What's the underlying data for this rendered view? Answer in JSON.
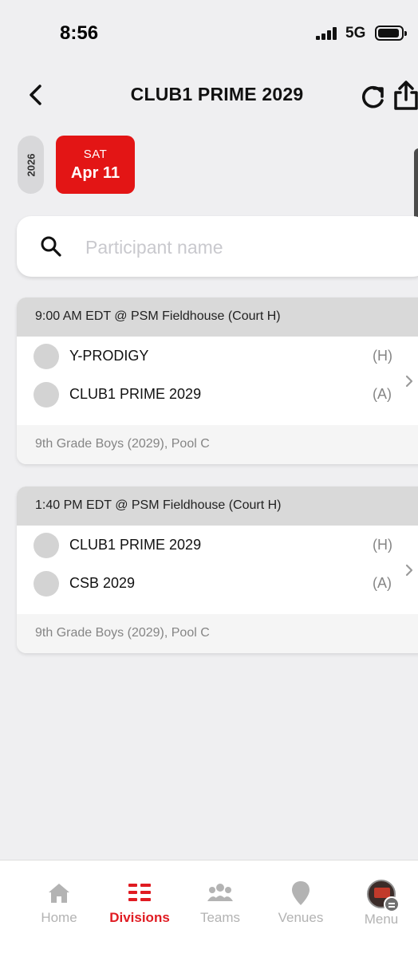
{
  "status": {
    "time": "8:56",
    "network": "5G"
  },
  "header": {
    "title": "CLUB1 PRIME 2029",
    "icons": {
      "back": "chevron-left-icon",
      "refresh": "refresh-icon",
      "share": "share-icon"
    }
  },
  "date_selector": {
    "year": "2026",
    "selected_day": "SAT",
    "selected_date": "Apr 11"
  },
  "search": {
    "placeholder": "Participant name",
    "value": "",
    "icon": "search-icon"
  },
  "matches": [
    {
      "time_location": "9:00 AM EDT @ PSM Fieldhouse (Court H)",
      "home_team": "Y-PRODIGY",
      "home_side": "(H)",
      "away_team": "CLUB1 PRIME 2029",
      "away_side": "(A)",
      "division": "9th Grade Boys (2029), Pool C"
    },
    {
      "time_location": "1:40 PM EDT @ PSM Fieldhouse (Court H)",
      "home_team": "CLUB1 PRIME 2029",
      "home_side": "(H)",
      "away_team": "CSB 2029",
      "away_side": "(A)",
      "division": "9th Grade Boys (2029), Pool C"
    }
  ],
  "tabs": [
    {
      "label": "Home",
      "icon": "home-icon",
      "active": false
    },
    {
      "label": "Divisions",
      "icon": "divisions-icon",
      "active": true
    },
    {
      "label": "Teams",
      "icon": "teams-icon",
      "active": false
    },
    {
      "label": "Venues",
      "icon": "venue-pin-icon",
      "active": false
    },
    {
      "label": "Menu",
      "icon": "menu-avatar-icon",
      "active": false
    }
  ],
  "colors": {
    "accent_red": "#e31515",
    "active_tab_red": "#e01b22",
    "inactive_tab_gray": "#b3b3b3",
    "card_header_gray": "#d9d9d9",
    "background": "#efeff1"
  }
}
